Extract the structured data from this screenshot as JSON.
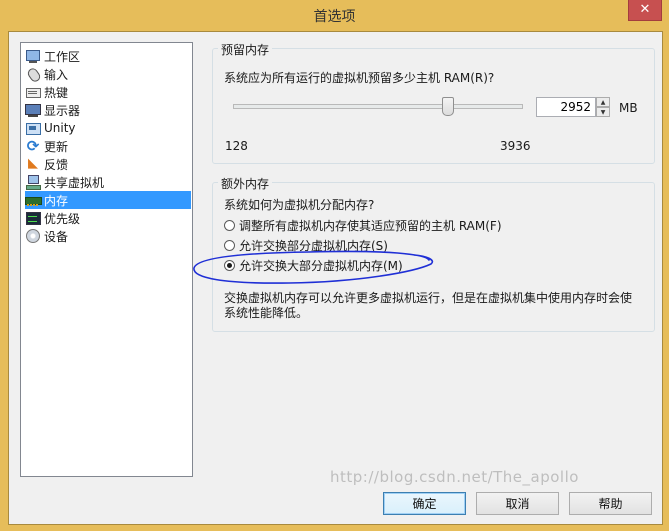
{
  "window": {
    "title": "首选项",
    "close_glyph": "✕"
  },
  "sidebar": {
    "items": [
      {
        "label": "工作区",
        "icon": "monitor-icon"
      },
      {
        "label": "输入",
        "icon": "mouse-icon"
      },
      {
        "label": "热键",
        "icon": "keyboard-icon"
      },
      {
        "label": "显示器",
        "icon": "display-icon"
      },
      {
        "label": "Unity",
        "icon": "unity-icon"
      },
      {
        "label": "更新",
        "icon": "update-icon"
      },
      {
        "label": "反馈",
        "icon": "feedback-icon"
      },
      {
        "label": "共享虚拟机",
        "icon": "shared-vm-icon"
      },
      {
        "label": "内存",
        "icon": "memory-icon",
        "selected": true
      },
      {
        "label": "优先级",
        "icon": "priority-icon"
      },
      {
        "label": "设备",
        "icon": "devices-icon"
      }
    ],
    "icon_glyphs": {
      "update": "⟳",
      "feedback": "◣"
    }
  },
  "reserved_memory": {
    "title": "预留内存",
    "question": "系统应为所有运行的虚拟机预留多少主机 RAM(R)?",
    "slider_min_label": "128",
    "slider_max_label": "3936",
    "slider_level_fraction": 0.74,
    "value": "2952",
    "unit": "MB",
    "spin_up": "▲",
    "spin_down": "▼"
  },
  "extra_memory": {
    "title": "额外内存",
    "question": "系统如何为虚拟机分配内存?",
    "options": [
      {
        "label": "调整所有虚拟机内存使其适应预留的主机 RAM(F)",
        "checked": false
      },
      {
        "label": "允许交换部分虚拟机内存(S)",
        "checked": false
      },
      {
        "label": "允许交换大部分虚拟机内存(M)",
        "checked": true
      }
    ],
    "description_line1": "交换虚拟机内存可以允许更多虚拟机运行，但是在虚拟机集中使用内存时会使",
    "description_line2": "系统性能降低。",
    "annotation_color": "#1f2fd6"
  },
  "buttons": {
    "ok": "确定",
    "cancel": "取消",
    "help": "帮助"
  },
  "watermark": "http://blog.csdn.net/The_apollo"
}
